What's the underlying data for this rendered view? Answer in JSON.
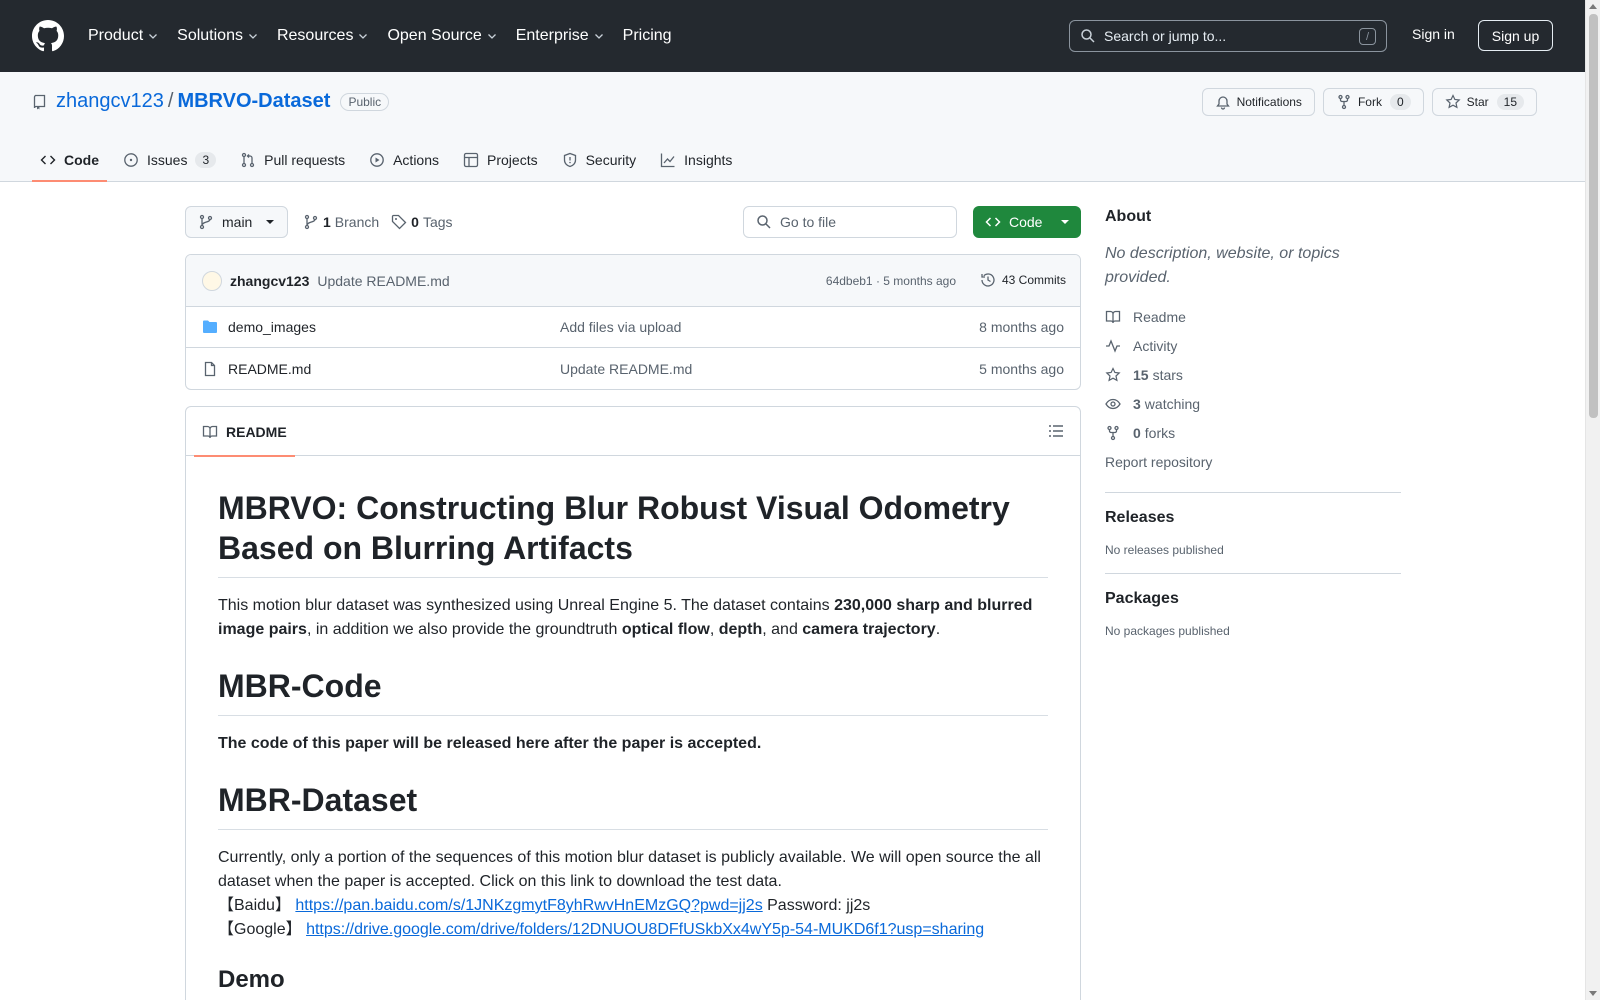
{
  "header": {
    "nav": [
      "Product",
      "Solutions",
      "Resources",
      "Open Source",
      "Enterprise",
      "Pricing"
    ],
    "search_placeholder": "Search or jump to...",
    "search_shortcut": "/",
    "signin": "Sign in",
    "signup": "Sign up"
  },
  "repo": {
    "owner": "zhangcv123",
    "separator": "/",
    "name": "MBRVO-Dataset",
    "visibility": "Public",
    "notifications_label": "Notifications",
    "fork_label": "Fork",
    "fork_count": "0",
    "star_label": "Star",
    "star_count": "15"
  },
  "tabs": [
    {
      "label": "Code",
      "active": true
    },
    {
      "label": "Issues",
      "count": "3"
    },
    {
      "label": "Pull requests"
    },
    {
      "label": "Actions"
    },
    {
      "label": "Projects"
    },
    {
      "label": "Security"
    },
    {
      "label": "Insights"
    }
  ],
  "toolbar": {
    "branch": "main",
    "branch_count": "1",
    "branch_label": "Branch",
    "tag_count": "0",
    "tag_label": "Tags",
    "goto_placeholder": "Go to file",
    "code_button": "Code"
  },
  "commit": {
    "author": "zhangcv123",
    "message": "Update README.md",
    "meta": "64dbeb1 · 5 months ago",
    "count_label": "43 Commits"
  },
  "files": [
    {
      "name": "demo_images",
      "type": "folder",
      "message": "Add files via upload",
      "age": "8 months ago"
    },
    {
      "name": "README.md",
      "type": "file",
      "message": "Update README.md",
      "age": "5 months ago"
    }
  ],
  "readme": {
    "tab_label": "README",
    "h1": "MBRVO: Constructing Blur Robust Visual Odometry Based on Blurring Artifacts",
    "intro_1": "This motion blur dataset was synthesized using Unreal Engine 5. The dataset contains ",
    "intro_b1": "230,000 sharp and blurred image pairs",
    "intro_2": ", in addition we also provide the groundtruth ",
    "intro_b2": "optical flow",
    "intro_3": ", ",
    "intro_b3": "depth",
    "intro_4": ", and ",
    "intro_b4": "camera trajectory",
    "intro_5": ".",
    "h2_code": "MBR-Code",
    "code_note": "The code of this paper will be released here after the paper is accepted.",
    "h2_dataset": "MBR-Dataset",
    "dataset_text": "Currently, only a portion of the sequences of this motion blur dataset is publicly available. We will open source the all dataset when the paper is accepted. Click on this link to download the test data.",
    "baidu_label": "【Baidu】",
    "baidu_link": "https://pan.baidu.com/s/1JNKzgmytF8yhRwvHnEMzGQ?pwd=jj2s",
    "baidu_pw": " Password: jj2s",
    "google_label": "【Google】",
    "google_link": "https://drive.google.com/drive/folders/12DNUOU8DFfUSkbXx4wY5p-54-MUKD6f1?usp=sharing",
    "h3_demo": "Demo"
  },
  "sidebar": {
    "about_title": "About",
    "about_desc": "No description, website, or topics provided.",
    "readme": "Readme",
    "activity": "Activity",
    "stars_count": "15",
    "stars_label": "stars",
    "watching_count": "3",
    "watching_label": "watching",
    "forks_count": "0",
    "forks_label": "forks",
    "report": "Report repository",
    "releases_title": "Releases",
    "releases_note": "No releases published",
    "packages_title": "Packages",
    "packages_note": "No packages published"
  },
  "colors": {
    "header_bg": "#24292f",
    "link": "#0969da",
    "code_button": "#1f883d",
    "active_tab_underline": "#fd8c73"
  }
}
